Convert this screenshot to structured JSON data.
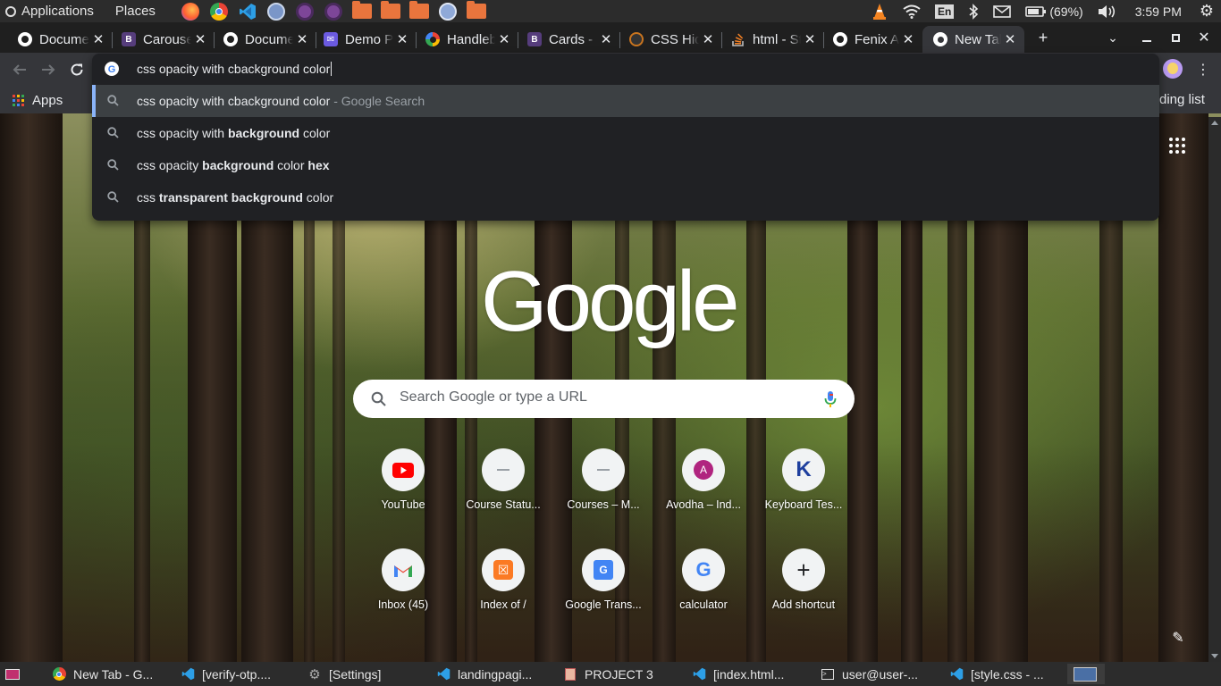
{
  "system_panel": {
    "applications_label": "Applications",
    "places_label": "Places",
    "keyboard_layout": "En",
    "battery": "(69%)",
    "clock": "3:59 PM"
  },
  "tabs": [
    {
      "title": "Documentation",
      "favicon": "globe-icon"
    },
    {
      "title": "Carousel",
      "favicon": "bootstrap-icon"
    },
    {
      "title": "Documentation",
      "favicon": "globe-icon"
    },
    {
      "title": "Demo Page",
      "favicon": "demo-icon"
    },
    {
      "title": "Handlebars",
      "favicon": "google-icon"
    },
    {
      "title": "Cards - Bootstrap",
      "favicon": "bootstrap-icon"
    },
    {
      "title": "CSS Hide",
      "favicon": "dark-icon"
    },
    {
      "title": "html - Stack Overflow",
      "favicon": "stackoverflow-icon"
    },
    {
      "title": "Fenix Admin",
      "favicon": "globe-icon"
    },
    {
      "title": "New Tab",
      "favicon": "chrome-icon"
    }
  ],
  "omnibox": {
    "input_value": "css opacity with cbackground color",
    "suggestions": [
      {
        "pre": "css opacity with cbackground color",
        "bold": "",
        "post": "",
        "suffix": " - Google Search"
      },
      {
        "pre": "css opacity with ",
        "bold": "background",
        "post": " color",
        "suffix": ""
      },
      {
        "pre": "css opacity ",
        "bold": "background",
        "post": " color ",
        "bold2": "hex"
      },
      {
        "pre": "css ",
        "bold": "transparent background",
        "post": " color",
        "suffix": ""
      }
    ]
  },
  "bookmarks": {
    "apps_label": "Apps",
    "right_text": "ding list"
  },
  "ntp": {
    "logo_text": "Google",
    "search_placeholder": "Search Google or type a URL",
    "shortcuts": [
      {
        "label": "YouTube",
        "icon": "youtube-icon"
      },
      {
        "label": "Course Statu...",
        "icon": "dash-icon"
      },
      {
        "label": "Courses – M...",
        "icon": "dash-icon"
      },
      {
        "label": "Avodha – Ind...",
        "icon": "letter-a-icon",
        "glyph": "A"
      },
      {
        "label": "Keyboard Tes...",
        "icon": "letter-k-icon",
        "glyph": "K"
      },
      {
        "label": "Inbox (45)",
        "icon": "gmail-icon"
      },
      {
        "label": "Index of /",
        "icon": "xampp-icon"
      },
      {
        "label": "Google Trans...",
        "icon": "translate-icon"
      },
      {
        "label": "calculator",
        "icon": "google-icon"
      },
      {
        "label": "Add shortcut",
        "icon": "plus-icon",
        "glyph": "+"
      }
    ]
  },
  "taskbar": [
    {
      "label": "New Tab - G...",
      "icon": "chrome-icon"
    },
    {
      "label": "[verify-otp....",
      "icon": "vscode-icon"
    },
    {
      "label": "[Settings]",
      "icon": "gear-icon"
    },
    {
      "label": "landingpagi...",
      "icon": "vscode-icon"
    },
    {
      "label": "PROJECT 3",
      "icon": "file-icon"
    },
    {
      "label": "[index.html...",
      "icon": "vscode-icon"
    },
    {
      "label": "user@user-...",
      "icon": "terminal-icon"
    },
    {
      "label": "[style.css - ...",
      "icon": "vscode-icon"
    }
  ]
}
